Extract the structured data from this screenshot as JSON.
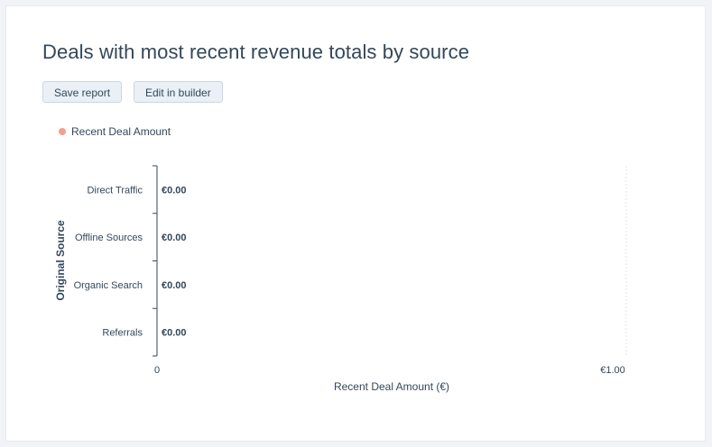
{
  "report": {
    "title": "Deals with most recent revenue totals by source",
    "save_label": "Save report",
    "edit_label": "Edit in builder"
  },
  "legend": {
    "label": "Recent Deal Amount",
    "color": "#f2a28b"
  },
  "chart_data": {
    "type": "bar",
    "orientation": "horizontal",
    "categories": [
      "Direct Traffic",
      "Offline Sources",
      "Organic Search",
      "Referrals"
    ],
    "series": [
      {
        "name": "Recent Deal Amount",
        "values": [
          0,
          0,
          0,
          0
        ],
        "color": "#f2a28b"
      }
    ],
    "data_labels": [
      "€0.00",
      "€0.00",
      "€0.00",
      "€0.00"
    ],
    "xlabel": "Recent Deal Amount (€)",
    "ylabel": "Original Source",
    "xlim": [
      0,
      1
    ],
    "x_ticks": [
      "0",
      "€1.00"
    ],
    "legend_position": "top-left"
  }
}
